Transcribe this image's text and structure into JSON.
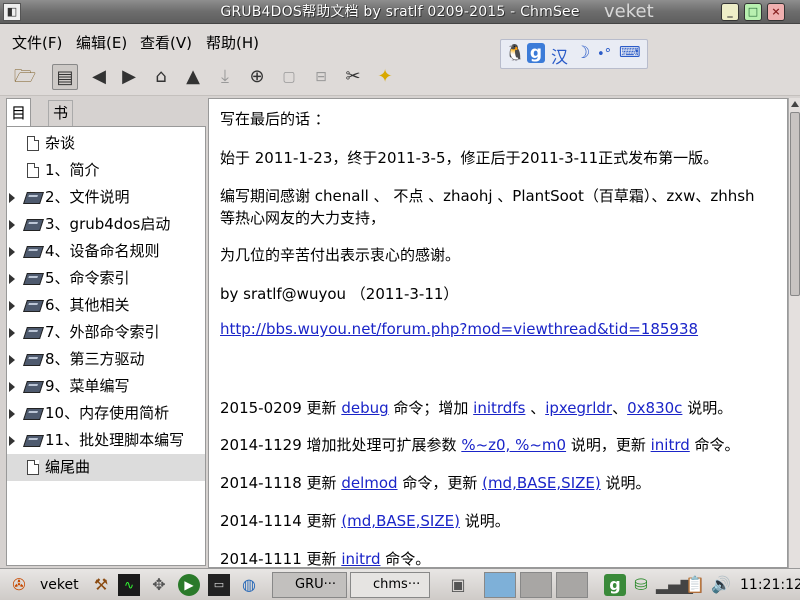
{
  "window": {
    "title": "GRUB4DOS帮助文档 by sratlf 0209-2015 - ChmSee",
    "brand": "veket",
    "icon": "chmsee-app-icon",
    "controls": [
      "minimize",
      "maximize",
      "close"
    ]
  },
  "menu": {
    "file": "文件(F)",
    "edit": "编辑(E)",
    "view": "查看(V)",
    "help": "帮助(H)"
  },
  "ime": {
    "g_label": "g",
    "lang": "汉"
  },
  "toolbar": [
    "open",
    "toggle-sidebar",
    "back",
    "forward",
    "home",
    "up",
    "bookmark",
    "zoom-in",
    "zoom-reset",
    "zoom-out",
    "settings",
    "favorites"
  ],
  "sidebar": {
    "tabs": [
      "目录",
      "书签"
    ],
    "items": [
      {
        "label": "杂谈",
        "type": "page",
        "expandable": false,
        "selected": false
      },
      {
        "label": "1、简介",
        "type": "page",
        "expandable": false,
        "selected": false
      },
      {
        "label": "2、文件说明",
        "type": "book",
        "expandable": true,
        "selected": false
      },
      {
        "label": "3、grub4dos启动",
        "type": "book",
        "expandable": true,
        "selected": false
      },
      {
        "label": "4、设备命名规则",
        "type": "book",
        "expandable": true,
        "selected": false
      },
      {
        "label": "5、命令索引",
        "type": "book",
        "expandable": true,
        "selected": false
      },
      {
        "label": "6、其他相关",
        "type": "book",
        "expandable": true,
        "selected": false
      },
      {
        "label": "7、外部命令索引",
        "type": "book",
        "expandable": true,
        "selected": false
      },
      {
        "label": "8、第三方驱动",
        "type": "book",
        "expandable": true,
        "selected": false
      },
      {
        "label": "9、菜单编写",
        "type": "book",
        "expandable": true,
        "selected": false
      },
      {
        "label": "10、内存使用简析",
        "type": "book",
        "expandable": true,
        "selected": false
      },
      {
        "label": "11、批处理脚本编写",
        "type": "book",
        "expandable": true,
        "selected": false
      },
      {
        "label": "编尾曲",
        "type": "page",
        "expandable": false,
        "selected": true
      }
    ]
  },
  "content": {
    "heading": "写在最后的话 ：",
    "para1": "始于 2011-1-23，终于2011-3-5，修正后于2011-3-11正式发布第一版。",
    "para2_line1": "编写期间感谢 chenall 、 不点 、zhaohj 、PlantSoot（百草霜）、zxw、zhhsh",
    "para2_line2": "等热心网友的大力支持，",
    "para3": "为几位的辛苦付出表示衷心的感谢。",
    "signature": "by sratlf@wuyou （2011-3-11）",
    "url": "http://bbs.wuyou.net/forum.php?mod=viewthread&tid=185938",
    "log": [
      {
        "date": "2015-0209",
        "parts": [
          {
            "t": " 更新 "
          },
          {
            "t": "debug",
            "link": true
          },
          {
            "t": " 命令；增加 "
          },
          {
            "t": "initrdfs",
            "link": true
          },
          {
            "t": " 、"
          },
          {
            "t": "ipxegrldr",
            "link": true
          },
          {
            "t": "、"
          },
          {
            "t": "0x830c",
            "link": true
          },
          {
            "t": " 说明。"
          }
        ]
      },
      {
        "date": "2014-1129",
        "parts": [
          {
            "t": " 增加批处理可扩展参数 "
          },
          {
            "t": "%~z0, %~m0",
            "link": true
          },
          {
            "t": " 说明，更新 "
          },
          {
            "t": "initrd",
            "link": true
          },
          {
            "t": " 命令。"
          }
        ]
      },
      {
        "date": "2014-1118",
        "parts": [
          {
            "t": " 更新 "
          },
          {
            "t": "delmod",
            "link": true
          },
          {
            "t": " 命令，更新 "
          },
          {
            "t": "(md,BASE,SIZE)",
            "link": true
          },
          {
            "t": " 说明。"
          }
        ]
      },
      {
        "date": "2014-1114",
        "parts": [
          {
            "t": " 更新 "
          },
          {
            "t": "(md,BASE,SIZE)",
            "link": true
          },
          {
            "t": " 说明。"
          }
        ]
      },
      {
        "date": "2014-1111",
        "parts": [
          {
            "t": " 更新 "
          },
          {
            "t": "initrd",
            "link": true
          },
          {
            "t": " 命令。"
          }
        ]
      }
    ]
  },
  "taskbar": {
    "start_label": "veket",
    "tasks": [
      {
        "label": "GRU···",
        "active": true
      },
      {
        "label": "chms···",
        "active": false
      }
    ],
    "tray_g": "g",
    "clock": "11:21:12"
  }
}
